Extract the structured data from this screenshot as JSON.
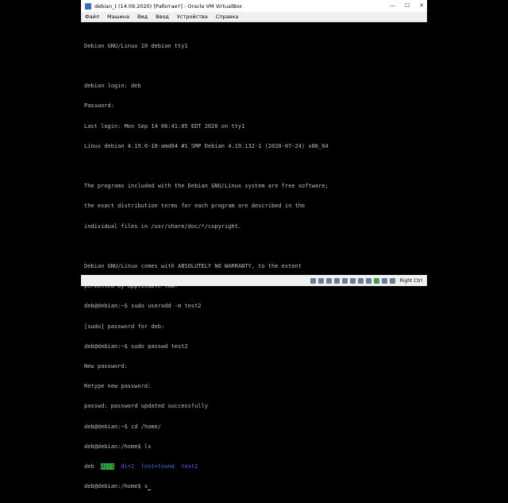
{
  "window": {
    "title": "debian_t (14.09.2020) [Работает] - Oracle VM VirtualBox",
    "controls": {
      "minimize": "—",
      "maximize": "☐",
      "close": "✕"
    }
  },
  "menu": {
    "items": [
      "Файл",
      "Машина",
      "Вид",
      "Ввод",
      "Устройства",
      "Справка"
    ]
  },
  "terminal": {
    "lines": [
      "Debian GNU/Linux 10 debian tty1",
      "",
      "debian login: deb",
      "Password:",
      "Last login: Mon Sep 14 06:41:05 EDT 2020 on tty1",
      "Linux debian 4.19.0-10-amd64 #1 SMP Debian 4.19.132-1 (2020-07-24) x86_64",
      "",
      "The programs included with the Debian GNU/Linux system are free software;",
      "the exact distribution terms for each program are described in the",
      "individual files in /usr/share/doc/*/copyright.",
      "",
      "Debian GNU/Linux comes with ABSOLUTELY NO WARRANTY, to the extent",
      "permitted by applicable law.",
      "deb@debian:~$ sudo useradd -m test2",
      "[sudo] password for deb:",
      "deb@debian:~$ sudo passwd test2",
      "New password:",
      "Retype new password:",
      "passwd: password updated successfully",
      "deb@debian:~$ cd /home/",
      "deb@debian:/home$ ls"
    ],
    "ls_output": {
      "deb": "deb",
      "dir1": "dir1",
      "dir2": "dir2",
      "lost": "lost+found",
      "test2": "test2"
    },
    "current_prompt": "deb@debian:/home$ s"
  },
  "status": {
    "host_key": "Right Ctrl"
  }
}
